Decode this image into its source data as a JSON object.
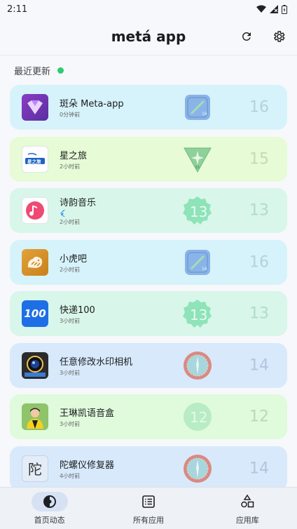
{
  "status": {
    "time": "2:11"
  },
  "header": {
    "title": "metá app"
  },
  "section": {
    "title": "最近更新",
    "dot_color": "#2ecc71"
  },
  "items": [
    {
      "name": "斑朵 Meta-app",
      "time": "0分钟前",
      "version": "16",
      "bg": "#d6f3fb",
      "ver_color": "#b3d2da",
      "icon": "meta-app-logo-icon",
      "badge": "android-16-badge-icon"
    },
    {
      "name": "星之旅",
      "time": "2小时前",
      "version": "15",
      "bg": "#e6fbd6",
      "ver_color": "#c3ddb0",
      "icon": "star-journey-logo-icon",
      "badge": "android-15-badge-icon"
    },
    {
      "name": "诗韵音乐",
      "time": "2小时前",
      "version": "13",
      "bg": "#d8f6ea",
      "ver_color": "#b0dcc9",
      "icon": "music-note-icon",
      "badge": "android-13-badge-icon",
      "extra": "flutter-icon"
    },
    {
      "name": "小虎吧",
      "time": "2小时前",
      "version": "16",
      "bg": "#d6f3fb",
      "ver_color": "#b3d2da",
      "icon": "tiger-logo-icon",
      "badge": "android-16-badge-icon"
    },
    {
      "name": "快递100",
      "time": "3小时前",
      "version": "13",
      "bg": "#d8f6ea",
      "ver_color": "#b0dcc9",
      "icon": "kuaidi100-logo-icon",
      "badge": "android-13-badge-icon",
      "icon_text": "100"
    },
    {
      "name": "任意修改水印相机",
      "time": "3小时前",
      "version": "14",
      "bg": "#d8e9fb",
      "ver_color": "#b0c6dd",
      "icon": "camera-lens-icon",
      "badge": "android-14-badge-icon"
    },
    {
      "name": "王琳凯语音盒",
      "time": "3小时前",
      "version": "12",
      "bg": "#e0fadc",
      "ver_color": "#b7dab3",
      "icon": "person-photo-icon",
      "badge": "android-12-badge-icon"
    },
    {
      "name": "陀螺仪修复器",
      "time": "4小时前",
      "version": "14",
      "bg": "#d8e9fb",
      "ver_color": "#b0c6dd",
      "icon": "tuo-char-icon",
      "badge": "android-14-badge-icon",
      "icon_text": "陀"
    }
  ],
  "nav": [
    {
      "label": "首页动态",
      "icon": "timeline-icon",
      "active": true
    },
    {
      "label": "所有应用",
      "icon": "list-icon",
      "active": false
    },
    {
      "label": "应用库",
      "icon": "shapes-icon",
      "active": false
    }
  ]
}
